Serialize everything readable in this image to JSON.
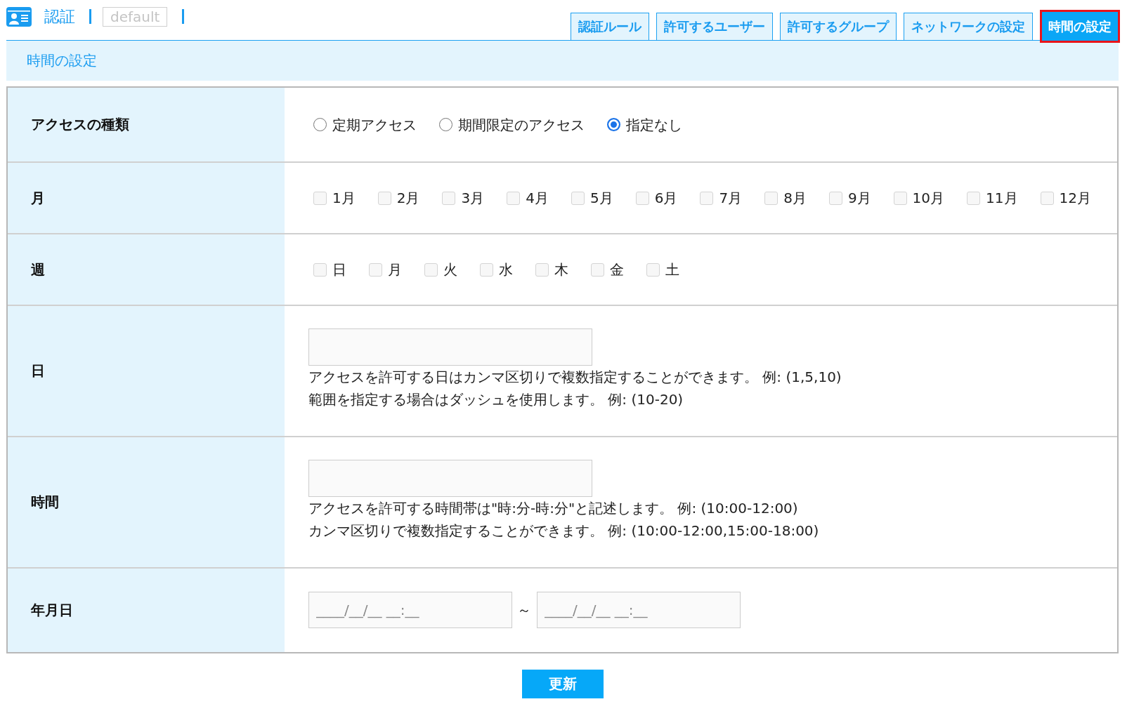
{
  "header": {
    "title": "認証",
    "profile": "default"
  },
  "tabs": [
    {
      "label": "認証ルール",
      "selected": false
    },
    {
      "label": "許可するユーザー",
      "selected": false
    },
    {
      "label": "許可するグループ",
      "selected": false
    },
    {
      "label": "ネットワークの設定",
      "selected": false
    },
    {
      "label": "時間の設定",
      "selected": true
    }
  ],
  "section_title": "時間の設定",
  "form": {
    "rows": [
      {
        "kind": "radio",
        "label": "アクセスの種類",
        "options": [
          {
            "label": "定期アクセス",
            "selected": false
          },
          {
            "label": "期間限定のアクセス",
            "selected": false
          },
          {
            "label": "指定なし",
            "selected": true
          }
        ]
      },
      {
        "kind": "checkbox",
        "label": "月",
        "options": [
          {
            "label": "1月",
            "checked": false
          },
          {
            "label": "2月",
            "checked": false
          },
          {
            "label": "3月",
            "checked": false
          },
          {
            "label": "4月",
            "checked": false
          },
          {
            "label": "5月",
            "checked": false
          },
          {
            "label": "6月",
            "checked": false
          },
          {
            "label": "7月",
            "checked": false
          },
          {
            "label": "8月",
            "checked": false
          },
          {
            "label": "9月",
            "checked": false
          },
          {
            "label": "10月",
            "checked": false
          },
          {
            "label": "11月",
            "checked": false
          },
          {
            "label": "12月",
            "checked": false
          }
        ]
      },
      {
        "kind": "checkbox",
        "label": "週",
        "options": [
          {
            "label": "日",
            "checked": false
          },
          {
            "label": "月",
            "checked": false
          },
          {
            "label": "火",
            "checked": false
          },
          {
            "label": "水",
            "checked": false
          },
          {
            "label": "木",
            "checked": false
          },
          {
            "label": "金",
            "checked": false
          },
          {
            "label": "土",
            "checked": false
          }
        ]
      },
      {
        "kind": "text",
        "label": "日",
        "hints": [
          "アクセスを許可する日はカンマ区切りで複数指定することができます。 例: (1,5,10)",
          "範囲を指定する場合はダッシュを使用します。 例: (10-20)"
        ]
      },
      {
        "kind": "text",
        "label": "時間",
        "hints": [
          "アクセスを許可する時間帯は\"時:分-時:分\"と記述します。 例: (10:00-12:00)",
          "カンマ区切りで複数指定することができます。 例: (10:00-12:00,15:00-18:00)"
        ]
      },
      {
        "kind": "daterange",
        "label": "年月日",
        "from": {
          "placeholder": "____/__/__ __:__"
        },
        "separator": "～",
        "to": {
          "placeholder": "____/__/__ __:__"
        }
      }
    ]
  },
  "submit": "更新"
}
